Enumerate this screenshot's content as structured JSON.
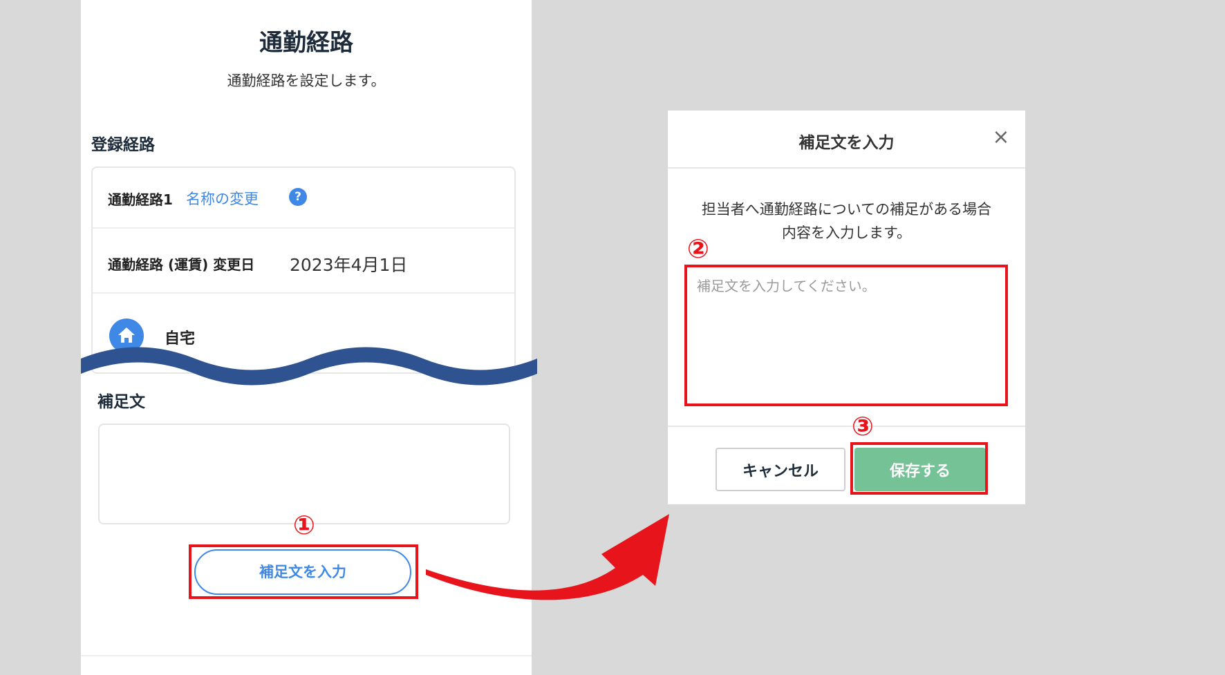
{
  "page": {
    "title": "通勤経路",
    "description": "通勤経路を設定します。"
  },
  "route_section": {
    "title": "登録経路",
    "route_name": "通勤経路1",
    "rename_link": "名称の変更",
    "help_icon": "?",
    "fare_change_label": "通勤経路 (運賃) 変更日",
    "fare_change_date": "2023年4月1日",
    "origin_label": "自宅"
  },
  "note_section": {
    "title": "補足文",
    "value": "",
    "enter_button": "補足文を入力"
  },
  "modal": {
    "title": "補足文を入力",
    "close_icon": "×",
    "description_line1": "担当者へ通勤経路についての補足がある場合",
    "description_line2": "内容を入力します。",
    "textarea_placeholder": "補足文を入力してください。",
    "cancel_button": "キャンセル",
    "save_button": "保存する"
  },
  "annotations": {
    "step1": "①",
    "step2": "②",
    "step3": "③"
  },
  "colors": {
    "accent_blue": "#3f88e6",
    "save_green": "#76c297",
    "annotation_red": "#e8141c",
    "wave_navy": "#2f5290"
  },
  "icons": {
    "home": "home-icon",
    "help": "question-icon",
    "close": "close-icon",
    "arrow": "curved-arrow-icon"
  }
}
